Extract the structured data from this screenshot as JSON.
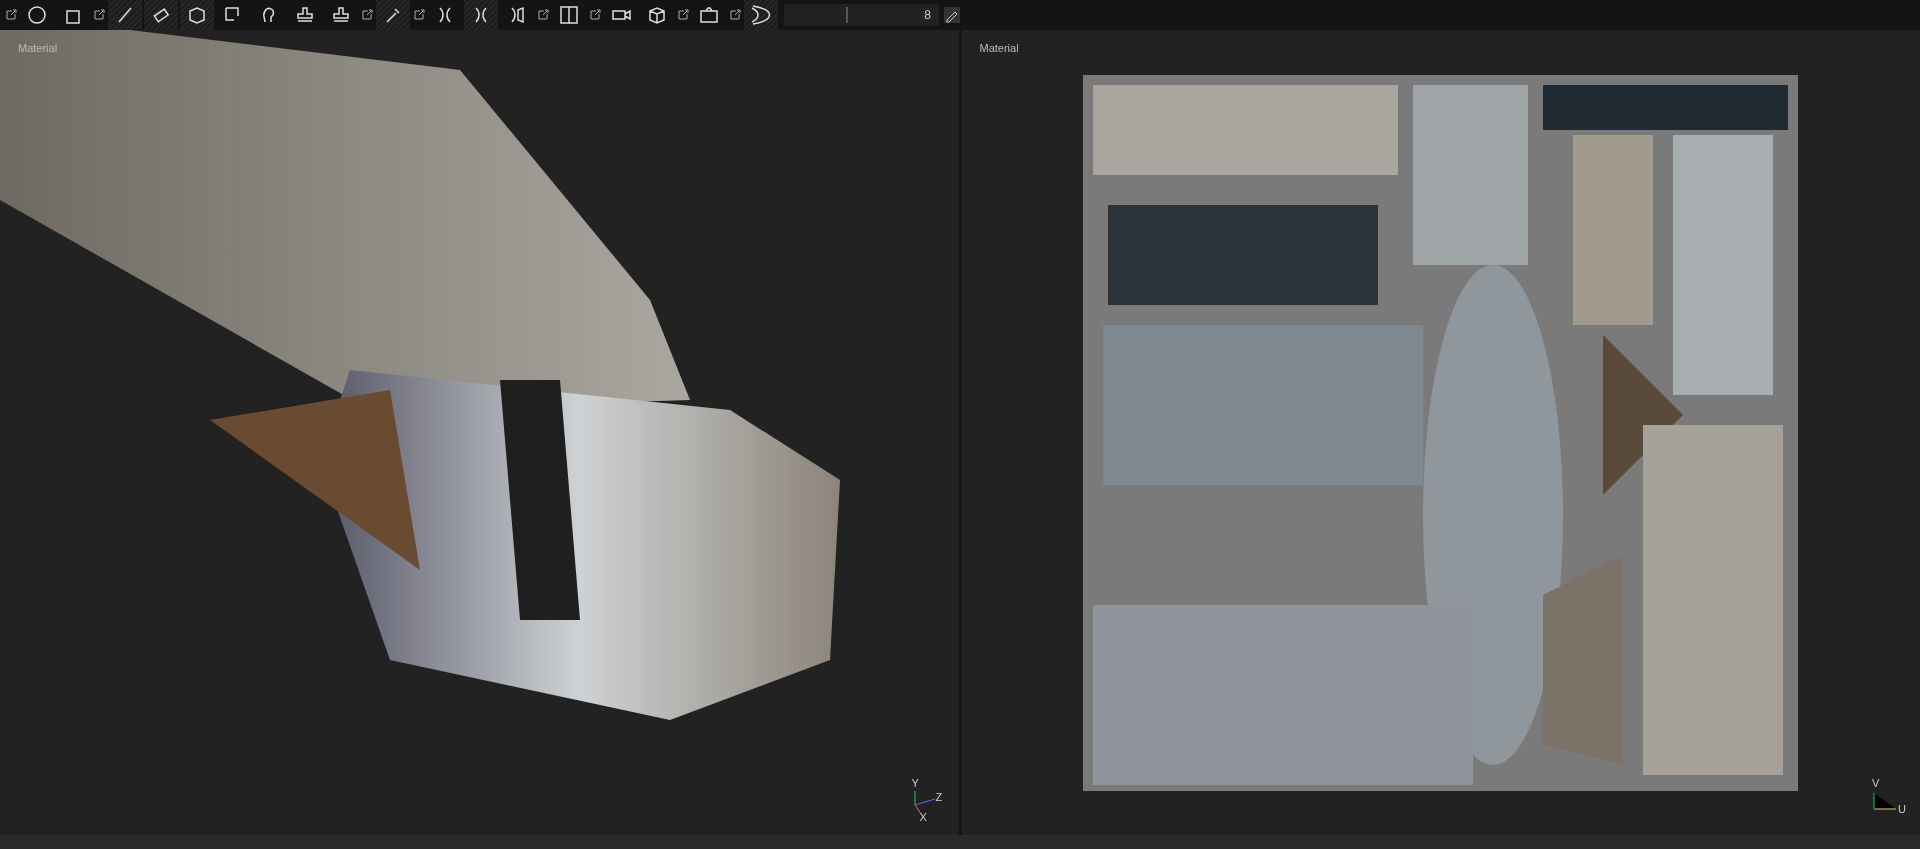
{
  "toolbar": {
    "brush_size": "8",
    "level": 0.4
  },
  "viewports": [
    {
      "kind": "model",
      "title": "Material",
      "axes": [
        "Y",
        "Z",
        "X"
      ]
    },
    {
      "kind": "uv",
      "title": "Material",
      "axes": [
        "V",
        "U"
      ]
    }
  ]
}
